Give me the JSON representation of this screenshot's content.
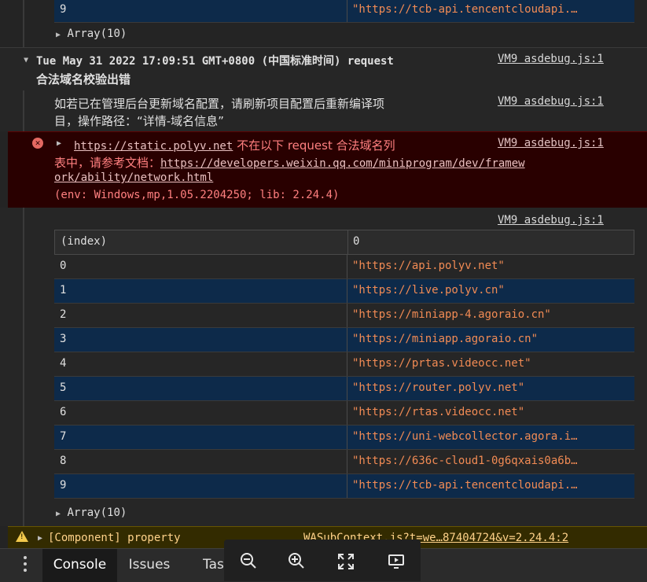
{
  "top_table": {
    "last_row": {
      "index": "9",
      "value": "\"https://tcb-api.tencentcloudapi.…"
    },
    "array_label": "Array(10)"
  },
  "group": {
    "header_line1": "Tue May 31 2022 17:09:51 GMT+0800 (中国标准时间) request",
    "header_line2": "合法域名校验出错",
    "source": "VM9 asdebug.js:1"
  },
  "info_message": {
    "line1": "如若已在管理后台更新域名配置，请刷新项目配置后重新编译项",
    "line2": "目，操作路径：“详情-域名信息”",
    "source": "VM9 asdebug.js:1"
  },
  "error_message": {
    "url": "https://static.polyv.net",
    "text1": " 不在以下 request 合法域名列",
    "text2": "表中，请参考文档：",
    "doc_link_1": "https://developers.weixin.qq.com/miniprogram/dev/framew",
    "doc_link_2": "ork/ability/network.html",
    "env": "(env: Windows,mp,1.05.2204250; lib: 2.24.4)",
    "source": "VM9 asdebug.js:1"
  },
  "table": {
    "source": "VM9 asdebug.js:1",
    "headers": [
      "(index)",
      "0"
    ],
    "rows": [
      {
        "index": "0",
        "value": "\"https://api.polyv.net\""
      },
      {
        "index": "1",
        "value": "\"https://live.polyv.cn\""
      },
      {
        "index": "2",
        "value": "\"https://miniapp-4.agoraio.cn\""
      },
      {
        "index": "3",
        "value": "\"https://miniapp.agoraio.cn\""
      },
      {
        "index": "4",
        "value": "\"https://prtas.videocc.net\""
      },
      {
        "index": "5",
        "value": "\"https://router.polyv.net\""
      },
      {
        "index": "6",
        "value": "\"https://rtas.videocc.net\""
      },
      {
        "index": "7",
        "value": "\"https://uni-webcollector.agora.i…"
      },
      {
        "index": "8",
        "value": "\"https://636c-cloud1-0g6qxais0a6b…"
      },
      {
        "index": "9",
        "value": "\"https://tcb-api.tencentcloudapi.…"
      }
    ],
    "array_label": "Array(10)"
  },
  "warning_message": {
    "text": "[Component] property",
    "source": "WASubContext.js?t=we…87404724&v=2.24.4:2"
  },
  "drawer": {
    "tabs": [
      "Console",
      "Issues",
      "Tas"
    ],
    "active_tab": "Console"
  },
  "toolbar": {
    "zoom_out": "zoom-out",
    "zoom_in": "zoom-in",
    "fit": "fit-screen",
    "present": "present"
  },
  "colors": {
    "error_bg": "#290000",
    "error_text": "#ff8080",
    "warning_bg": "#332b00",
    "row_alt": "#0d2a4a",
    "string": "#f28b54"
  }
}
